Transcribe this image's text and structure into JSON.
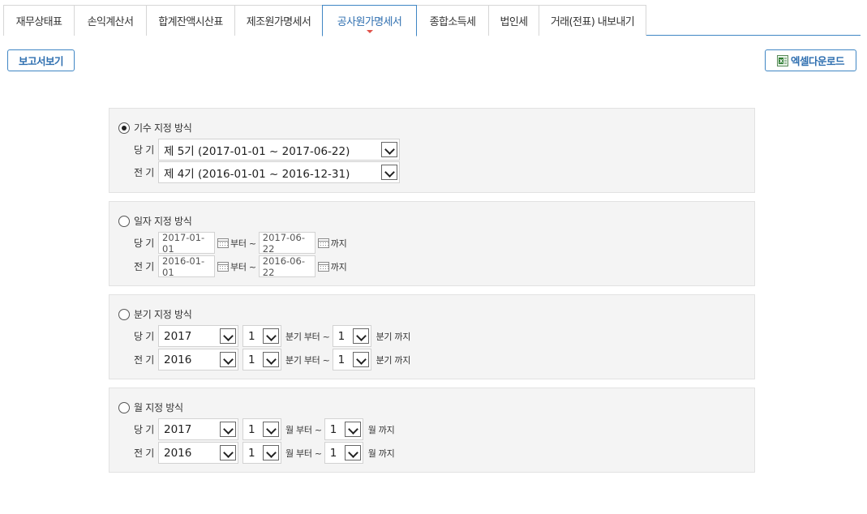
{
  "tabs": [
    {
      "label": "재무상태표"
    },
    {
      "label": "손익계산서"
    },
    {
      "label": "합계잔액시산표"
    },
    {
      "label": "제조원가명세서"
    },
    {
      "label": "공사원가명세서"
    },
    {
      "label": "종합소득세"
    },
    {
      "label": "법인세"
    },
    {
      "label": "거래(전표) 내보내기"
    }
  ],
  "toolbar": {
    "report_label": "보고서보기",
    "excel_label": "엑셀다운로드"
  },
  "colors": {
    "accent": "#3f86c4",
    "tab_indicator": "#e0524a",
    "section_bg": "#f4f4f4"
  },
  "fiscal": {
    "label": "기수 지정 방식",
    "current_label": "당 기",
    "current_value": "제 5기 (2017-01-01 ~ 2017-06-22)",
    "prev_label": "전 기",
    "prev_value": "제 4기 (2016-01-01 ~ 2016-12-31)"
  },
  "date": {
    "label": "일자 지정 방식",
    "current_label": "당 기",
    "current_from": "2017-01-01",
    "current_to": "2017-06-22",
    "prev_label": "전 기",
    "prev_from": "2016-01-01",
    "prev_to": "2016-06-22",
    "from_text": "부터 ~",
    "to_text": "까지"
  },
  "quarter": {
    "label": "분기 지정 방식",
    "current_label": "당 기",
    "current_year": "2017",
    "current_from": "1",
    "current_to": "1",
    "prev_label": "전 기",
    "prev_year": "2016",
    "prev_from": "1",
    "prev_to": "1",
    "from_text": "분기 부터 ~",
    "to_text": "분기 까지"
  },
  "month": {
    "label": "월 지정 방식",
    "current_label": "당 기",
    "current_year": "2017",
    "current_from": "1",
    "current_to": "1",
    "prev_label": "전 기",
    "prev_year": "2016",
    "prev_from": "1",
    "prev_to": "1",
    "from_text": "월 부터 ~",
    "to_text": "월 까지"
  }
}
